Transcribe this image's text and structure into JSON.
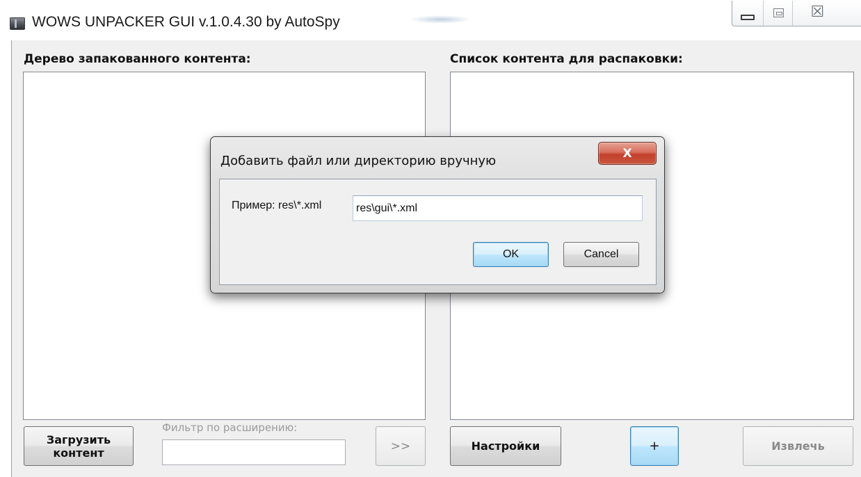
{
  "window": {
    "title": "WOWS UNPACKER GUI v.1.0.4.30 by AutoSpy",
    "icon": "app-cube-icon",
    "controls": {
      "minimize": "minimize-icon",
      "maximize": "maximize-icon",
      "close": "close-icon",
      "close_glyph": "☒"
    }
  },
  "left_panel": {
    "label": "Дерево запакованного контента:",
    "load_button": "Загрузить контент",
    "filter_label": "Фильтр по расширению:",
    "filter_value": "",
    "move_button": ">>"
  },
  "right_panel": {
    "label": "Список контента для распаковки:",
    "settings_button": "Настройки",
    "add_button": "+",
    "extract_button": "Извлечь"
  },
  "dialog": {
    "title": "Добавить файл или директорию вручную",
    "close_glyph": "X",
    "hint": "Пример: res\\*.xml",
    "input_value": "res\\gui\\*.xml",
    "ok_button": "OK",
    "cancel_button": "Cancel"
  },
  "colors": {
    "window_bg": "#f0f0f0",
    "accent_button": "#bee6fd",
    "dialog_close": "#c2402c"
  }
}
